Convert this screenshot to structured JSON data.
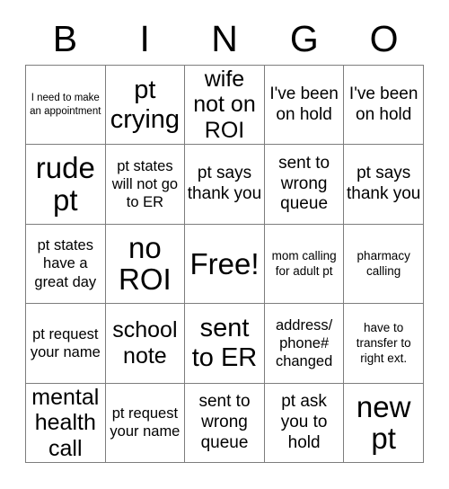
{
  "header": {
    "letters": [
      "B",
      "I",
      "N",
      "G",
      "O"
    ]
  },
  "grid": {
    "rows": 5,
    "columns": 5,
    "border_color": "#7d7d7d",
    "background_color": "#ffffff",
    "text_color": "#000000",
    "cells": [
      {
        "text": "I need to make an appointment",
        "size": "fs-xs"
      },
      {
        "text": "pt crying",
        "size": "fs-2xl"
      },
      {
        "text": "wife not on ROI",
        "size": "fs-xl"
      },
      {
        "text": "I've been on hold",
        "size": "fs-lg"
      },
      {
        "text": "I've been on hold",
        "size": "fs-lg"
      },
      {
        "text": "rude pt",
        "size": "fs-3xl"
      },
      {
        "text": "pt states will not go to ER",
        "size": "fs-md"
      },
      {
        "text": "pt says thank you",
        "size": "fs-lg"
      },
      {
        "text": "sent to wrong queue",
        "size": "fs-lg"
      },
      {
        "text": "pt says thank you",
        "size": "fs-lg"
      },
      {
        "text": "pt states have a great day",
        "size": "fs-md"
      },
      {
        "text": "no ROI",
        "size": "fs-3xl"
      },
      {
        "text": "Free!",
        "size": "fs-3xl"
      },
      {
        "text": "mom calling for adult pt",
        "size": "fs-sm"
      },
      {
        "text": "pharmacy calling",
        "size": "fs-sm"
      },
      {
        "text": "pt request your name",
        "size": "fs-md"
      },
      {
        "text": "school note",
        "size": "fs-xl"
      },
      {
        "text": "sent to ER",
        "size": "fs-2xl"
      },
      {
        "text": "address/ phone# changed",
        "size": "fs-md"
      },
      {
        "text": "have to transfer to right ext.",
        "size": "fs-sm"
      },
      {
        "text": "mental health call",
        "size": "fs-xl"
      },
      {
        "text": "pt request your name",
        "size": "fs-md"
      },
      {
        "text": "sent to wrong queue",
        "size": "fs-lg"
      },
      {
        "text": "pt ask you to hold",
        "size": "fs-lg"
      },
      {
        "text": "new pt",
        "size": "fs-3xl"
      }
    ]
  }
}
